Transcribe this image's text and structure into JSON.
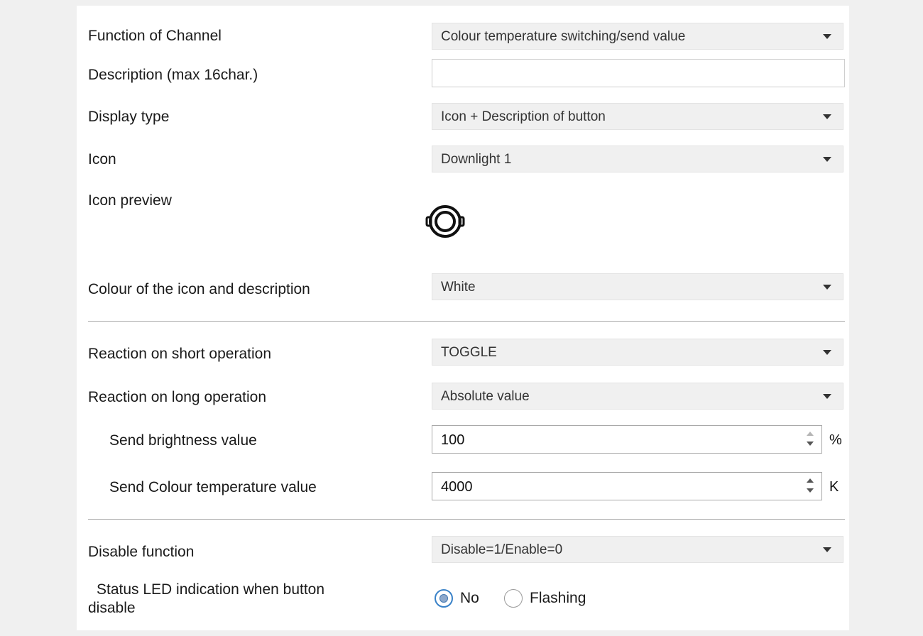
{
  "rows": {
    "function_of_channel": {
      "label": "Function of Channel",
      "value": "Colour temperature switching/send value"
    },
    "description": {
      "label": "Description (max 16char.)",
      "value": ""
    },
    "display_type": {
      "label": "Display type",
      "value": "Icon + Description of button"
    },
    "icon": {
      "label": "Icon",
      "value": "Downlight 1"
    },
    "icon_preview": {
      "label": "Icon preview",
      "icon": "downlight-icon"
    },
    "colour": {
      "label": "Colour of the icon and description",
      "value": "White"
    },
    "short_operation": {
      "label": "Reaction on short operation",
      "value": "TOGGLE"
    },
    "long_operation": {
      "label": "Reaction on long operation",
      "value": "Absolute value"
    },
    "brightness": {
      "label": "Send brightness value",
      "value": "100",
      "unit": "%"
    },
    "colour_temperature": {
      "label": "Send Colour temperature value",
      "value": "4000",
      "unit": "K"
    },
    "disable_function": {
      "label": "Disable function",
      "value": "Disable=1/Enable=0"
    },
    "status_led": {
      "label_line1": "Status LED indication when button",
      "label_line2": "disable",
      "options": [
        "No",
        "Flashing"
      ],
      "selected": "No"
    }
  },
  "colors": {
    "accent": "#3a82c8",
    "background": "#f0f0f0",
    "field": "#f0f0f0"
  }
}
